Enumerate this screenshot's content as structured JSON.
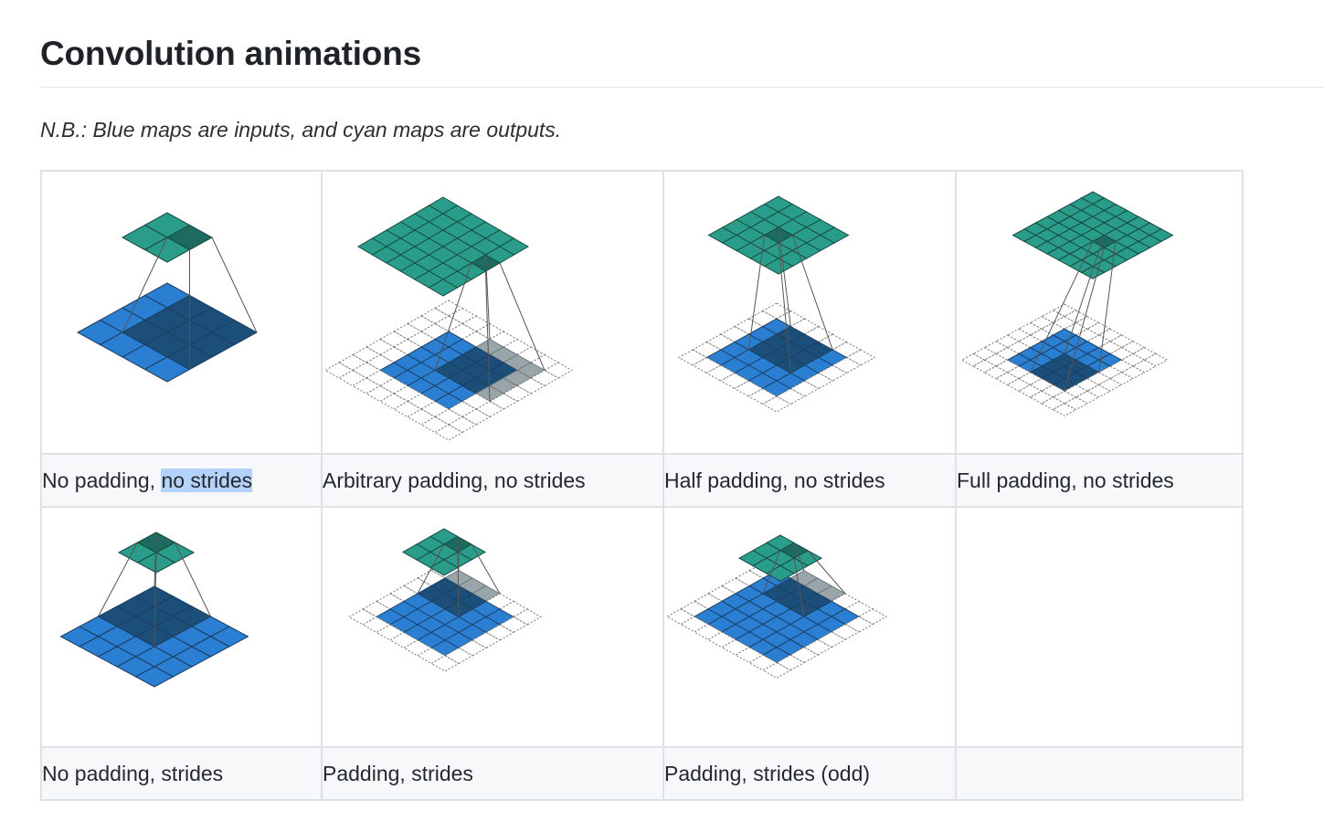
{
  "page": {
    "heading": "Convolution animations",
    "note": "N.B.: Blue maps are inputs, and cyan maps are outputs."
  },
  "cells": [
    {
      "caption_pre": "No padding, ",
      "caption_sel": "no strides",
      "caption_post": ""
    },
    {
      "caption": "Arbitrary padding, no strides"
    },
    {
      "caption": "Half padding, no strides"
    },
    {
      "caption": "Full padding, no strides"
    },
    {
      "caption": "No padding, strides"
    },
    {
      "caption": "Padding, strides"
    },
    {
      "caption": "Padding, strides (odd)"
    },
    {
      "caption": ""
    }
  ],
  "colors": {
    "input_blue": "#2a7fd3",
    "input_highlight": "#1b4f7a",
    "output_cyan": "#2a9d8a",
    "output_highlight": "#1c6b5e",
    "padding_highlight": "#9aa5aa"
  }
}
